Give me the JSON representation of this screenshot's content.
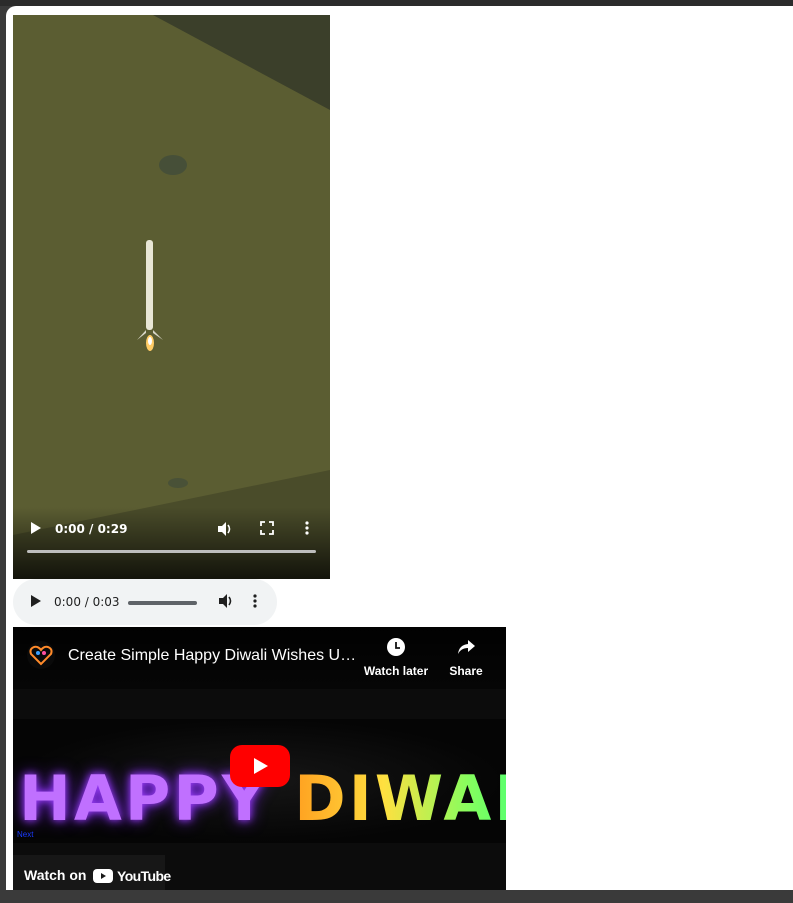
{
  "video": {
    "time": "0:00 / 0:29",
    "progress": 0
  },
  "audio": {
    "time": "0:00 / 0:03"
  },
  "youtube": {
    "title": "Create Simple Happy Diwali Wishes Us...",
    "watch_later": "Watch later",
    "share": "Share",
    "banner_word1": "HAPPY",
    "banner_word2": "DIWALI",
    "small_text": "Next",
    "watch_on": "Watch on",
    "youtube_brand": "YouTube"
  },
  "colors": {
    "youtube_red": "#ff0000",
    "audio_bg": "#f1f3f4"
  }
}
